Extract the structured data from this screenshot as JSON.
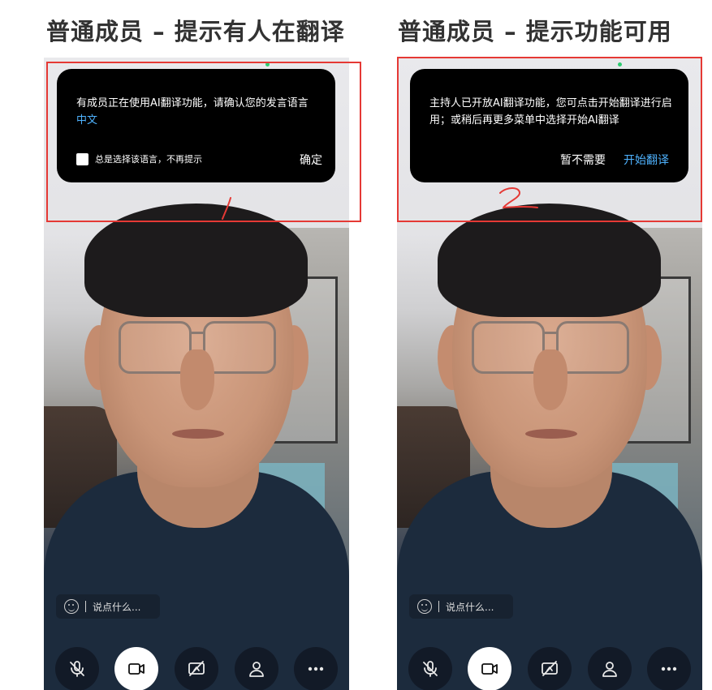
{
  "panels": [
    {
      "title": "普通成员 – 提示有人在翻译",
      "dialog": {
        "message": "有成员正在使用AI翻译功能，请确认您的发言语言",
        "language": "中文",
        "checkbox_label": "总是选择该语言，不再提示",
        "confirm_label": "确定"
      },
      "chat_placeholder": "说点什么...",
      "annotation": "1"
    },
    {
      "title": "普通成员 – 提示功能可用",
      "dialog": {
        "message": "主持人已开放AI翻译功能，您可点击开始翻译进行启用；或稍后再更多菜单中选择开始AI翻译",
        "later_label": "暂不需要",
        "start_label": "开始翻译"
      },
      "chat_placeholder": "说点什么...",
      "annotation": "2"
    }
  ],
  "toolbar_icons": [
    "mic-off-icon",
    "video-camera-icon",
    "screen-share-off-icon",
    "members-icon",
    "more-icon"
  ],
  "colors": {
    "accent": "#4fb3ff",
    "dialog_bg": "#000000",
    "annotation_red": "#e53935",
    "status_dot": "#2ecc71"
  }
}
